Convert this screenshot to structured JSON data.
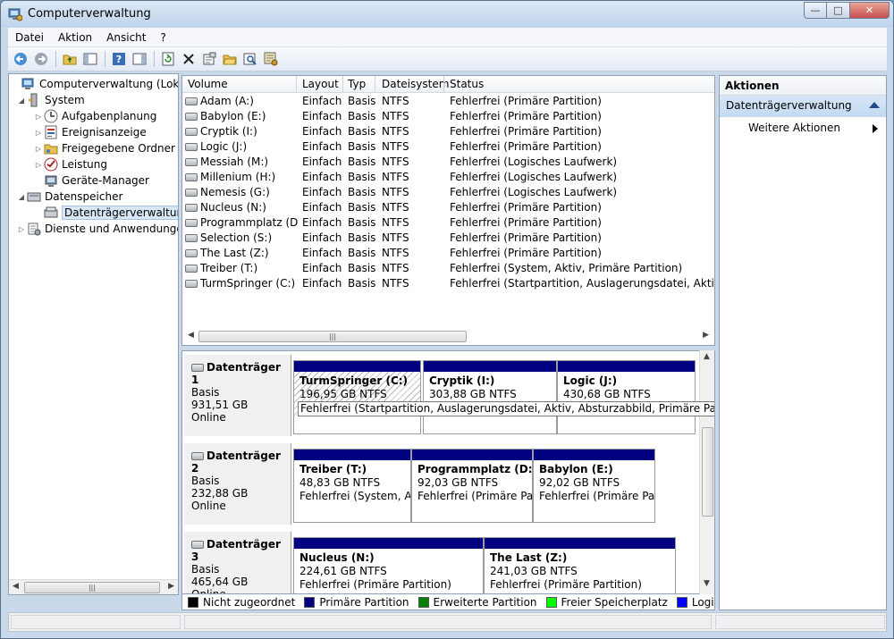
{
  "window": {
    "title": "Computerverwaltung",
    "minimize": "—",
    "maximize": "□",
    "close": "✕"
  },
  "menu": [
    "Datei",
    "Aktion",
    "Ansicht",
    "?"
  ],
  "toolbar": [
    "back-icon",
    "forward-icon",
    "up-folder-icon",
    "show-hide-tree-icon",
    "help-icon",
    "show-hide-action-pane-icon",
    "refresh-icon",
    "delete-icon",
    "properties-icon",
    "open-icon",
    "search-icon",
    "settings-icon"
  ],
  "tree": {
    "root": "Computerverwaltung (Lokal)",
    "system": "System",
    "system_items": [
      "Aufgabenplanung",
      "Ereignisanzeige",
      "Freigegebene Ordner",
      "Leistung",
      "Geräte-Manager"
    ],
    "storage": "Datenspeicher",
    "disk_mgmt": "Datenträgerverwaltung",
    "services": "Dienste und Anwendungen"
  },
  "volumes": {
    "headers": [
      "Volume",
      "Layout",
      "Typ",
      "Dateisystem",
      "Status"
    ],
    "rows": [
      [
        "Adam (A:)",
        "Einfach",
        "Basis",
        "NTFS",
        "Fehlerfrei (Primäre Partition)"
      ],
      [
        "Babylon (E:)",
        "Einfach",
        "Basis",
        "NTFS",
        "Fehlerfrei (Primäre Partition)"
      ],
      [
        "Cryptik (I:)",
        "Einfach",
        "Basis",
        "NTFS",
        "Fehlerfrei (Primäre Partition)"
      ],
      [
        "Logic (J:)",
        "Einfach",
        "Basis",
        "NTFS",
        "Fehlerfrei (Primäre Partition)"
      ],
      [
        "Messiah (M:)",
        "Einfach",
        "Basis",
        "NTFS",
        "Fehlerfrei (Logisches Laufwerk)"
      ],
      [
        "Millenium (H:)",
        "Einfach",
        "Basis",
        "NTFS",
        "Fehlerfrei (Logisches Laufwerk)"
      ],
      [
        "Nemesis (G:)",
        "Einfach",
        "Basis",
        "NTFS",
        "Fehlerfrei (Logisches Laufwerk)"
      ],
      [
        "Nucleus (N:)",
        "Einfach",
        "Basis",
        "NTFS",
        "Fehlerfrei (Primäre Partition)"
      ],
      [
        "Programmplatz (D:)",
        "Einfach",
        "Basis",
        "NTFS",
        "Fehlerfrei (Primäre Partition)"
      ],
      [
        "Selection (S:)",
        "Einfach",
        "Basis",
        "NTFS",
        "Fehlerfrei (Primäre Partition)"
      ],
      [
        "The Last (Z:)",
        "Einfach",
        "Basis",
        "NTFS",
        "Fehlerfrei (Primäre Partition)"
      ],
      [
        "Treiber (T:)",
        "Einfach",
        "Basis",
        "NTFS",
        "Fehlerfrei (System, Aktiv, Primäre Partition)"
      ],
      [
        "TurmSpringer (C:)",
        "Einfach",
        "Basis",
        "NTFS",
        "Fehlerfrei (Startpartition, Auslagerungsdatei, Aktiv, Abstu"
      ]
    ]
  },
  "disks": [
    {
      "name": "Datenträger 1",
      "type": "Basis",
      "size": "931,51 GB",
      "state": "Online",
      "parts": [
        {
          "name": "TurmSpringer  (C:)",
          "size": "196,95 GB NTFS",
          "status": "Fehlerfrei (Startpartition, Auslagerungsdatei, Aktiv, Absturzabbild, Primäre Partition)"
        },
        {
          "name": "Cryptik  (I:)",
          "size": "303,88 GB NTFS",
          "status": ""
        },
        {
          "name": "Logic  (J:)",
          "size": "430,68 GB NTFS",
          "status": ""
        }
      ]
    },
    {
      "name": "Datenträger 2",
      "type": "Basis",
      "size": "232,88 GB",
      "state": "Online",
      "parts": [
        {
          "name": "Treiber  (T:)",
          "size": "48,83 GB NTFS",
          "status": "Fehlerfrei (System, Ak"
        },
        {
          "name": "Programmplatz  (D:)",
          "size": "92,03 GB NTFS",
          "status": "Fehlerfrei (Primäre Part"
        },
        {
          "name": "Babylon  (E:)",
          "size": "92,02 GB NTFS",
          "status": "Fehlerfrei (Primäre Parti"
        }
      ]
    },
    {
      "name": "Datenträger 3",
      "type": "Basis",
      "size": "465,64 GB",
      "state": "Online",
      "parts": [
        {
          "name": "Nucleus  (N:)",
          "size": "224,61 GB NTFS",
          "status": "Fehlerfrei (Primäre Partition)"
        },
        {
          "name": "The Last  (Z:)",
          "size": "241,03 GB NTFS",
          "status": "Fehlerfrei (Primäre Partition)"
        }
      ]
    }
  ],
  "legend": [
    {
      "label": "Nicht zugeordnet",
      "color": "#000000"
    },
    {
      "label": "Primäre Partition",
      "color": "#000080"
    },
    {
      "label": "Erweiterte Partition",
      "color": "#008000"
    },
    {
      "label": "Freier Speicherplatz",
      "color": "#00ff00"
    },
    {
      "label": "Logisches Laufwerk",
      "color": "#0000ff"
    }
  ],
  "actions": {
    "title": "Aktionen",
    "section": "Datenträgerverwaltung",
    "item": "Weitere Aktionen"
  }
}
